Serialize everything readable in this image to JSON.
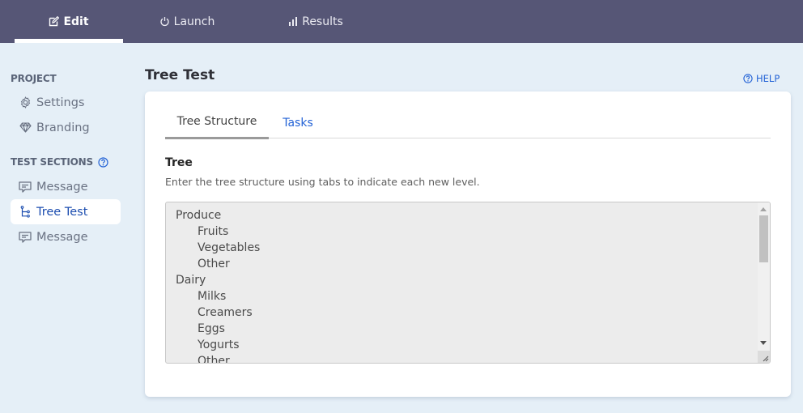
{
  "topnav": {
    "tabs": [
      {
        "label": "Edit",
        "icon": "edit-icon",
        "active": true
      },
      {
        "label": "Launch",
        "icon": "power-icon",
        "active": false
      },
      {
        "label": "Results",
        "icon": "bar-chart-icon",
        "active": false
      }
    ]
  },
  "sidebar": {
    "project_heading": "PROJECT",
    "project_items": [
      {
        "label": "Settings",
        "icon": "gear-icon"
      },
      {
        "label": "Branding",
        "icon": "diamond-icon"
      }
    ],
    "sections_heading": "TEST SECTIONS",
    "section_items": [
      {
        "label": "Message",
        "icon": "message-icon",
        "active": false
      },
      {
        "label": "Tree Test",
        "icon": "tree-icon",
        "active": true
      },
      {
        "label": "Message",
        "icon": "message-icon",
        "active": false
      }
    ]
  },
  "main": {
    "title": "Tree Test",
    "help_label": "HELP",
    "tabs": [
      {
        "label": "Tree Structure",
        "active": true
      },
      {
        "label": "Tasks",
        "active": false
      }
    ],
    "field_label": "Tree",
    "field_help": "Enter the tree structure using tabs to indicate each new level.",
    "tree_lines": [
      {
        "text": "Produce",
        "level": 0
      },
      {
        "text": "Fruits",
        "level": 1
      },
      {
        "text": "Vegetables",
        "level": 1
      },
      {
        "text": "Other",
        "level": 1
      },
      {
        "text": "Dairy",
        "level": 0
      },
      {
        "text": "Milks",
        "level": 1
      },
      {
        "text": "Creamers",
        "level": 1
      },
      {
        "text": "Eggs",
        "level": 1
      },
      {
        "text": "Yogurts",
        "level": 1
      },
      {
        "text": "Other",
        "level": 1
      }
    ]
  },
  "colors": {
    "nav_bg": "#565676",
    "page_bg": "#e5eff7",
    "accent": "#2463d6",
    "active_sidebar_text": "#1d4eb0"
  }
}
